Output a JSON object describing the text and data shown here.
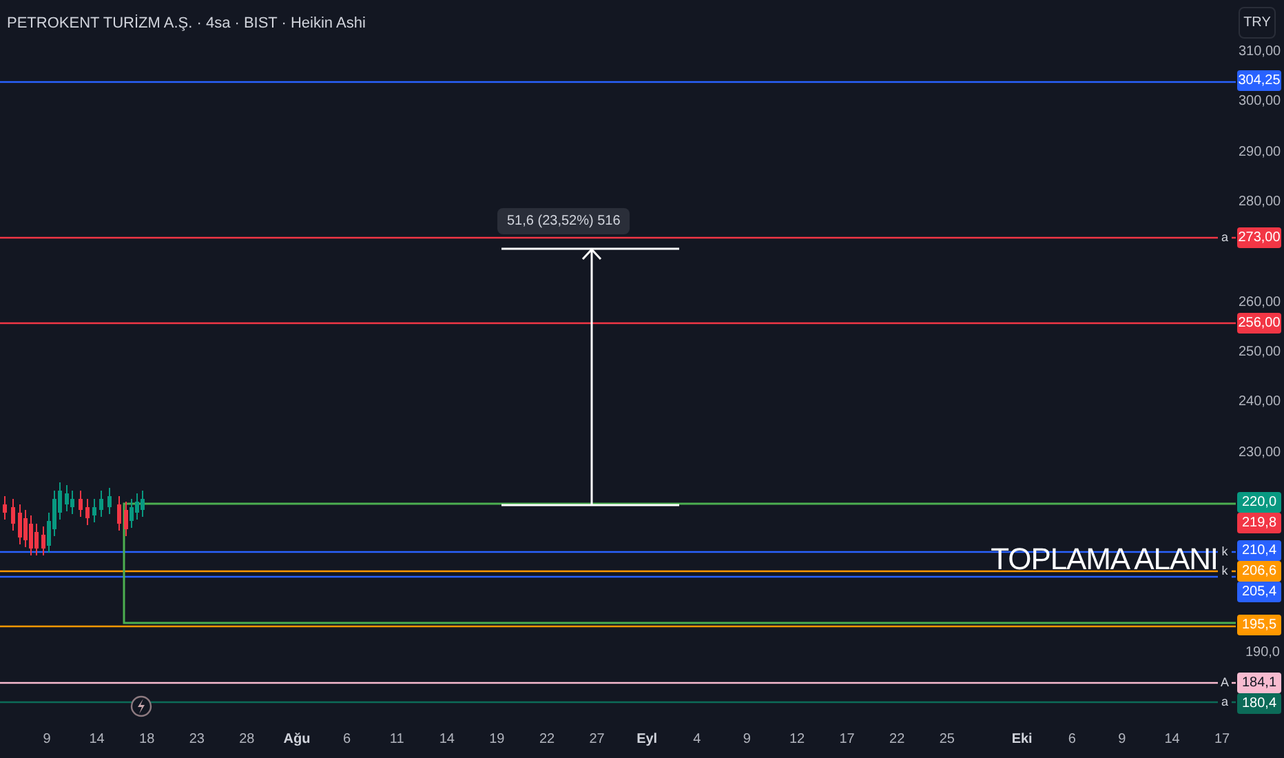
{
  "title": "PETROKENT TURİZM A.Ş. · 4sa · BIST · Heikin Ashi",
  "currency_button": "TRY",
  "price_ticks": [
    "310,00",
    "300,00",
    "290,00",
    "280,00",
    "260,00",
    "250,00",
    "240,00",
    "230,00",
    "190,0"
  ],
  "price_tags": [
    {
      "label": "304,25",
      "color": "#2962ff",
      "kind": "level"
    },
    {
      "label": "273,00",
      "color": "#f23645",
      "kind": "level",
      "marker": "a"
    },
    {
      "label": "256,00",
      "color": "#f23645",
      "kind": "level"
    },
    {
      "label": "220,0",
      "color": "#089981",
      "kind": "price"
    },
    {
      "label": "219,8",
      "color": "#f23645",
      "kind": "price"
    },
    {
      "label": "210,4",
      "color": "#2962ff",
      "kind": "level",
      "marker": "k"
    },
    {
      "label": "206,6",
      "color": "#ff9800",
      "kind": "level",
      "marker": "k"
    },
    {
      "label": "205,4",
      "color": "#2962ff",
      "kind": "level"
    },
    {
      "label": "195,5",
      "color": "#ff9800",
      "kind": "level"
    },
    {
      "label": "184,1",
      "color": "#f8bbd0",
      "kind": "level",
      "marker": "A"
    },
    {
      "label": "180,4",
      "color": "#0c6b58",
      "kind": "level",
      "marker": "a"
    }
  ],
  "measure": {
    "label": "51,6 (23,52%) 516"
  },
  "zone_label": "TOPLAMA ALANI",
  "time_labels": [
    {
      "label": "9",
      "kind": "day"
    },
    {
      "label": "14",
      "kind": "day"
    },
    {
      "label": "18",
      "kind": "day"
    },
    {
      "label": "23",
      "kind": "day"
    },
    {
      "label": "28",
      "kind": "day"
    },
    {
      "label": "Ağu",
      "kind": "month"
    },
    {
      "label": "6",
      "kind": "day"
    },
    {
      "label": "11",
      "kind": "day"
    },
    {
      "label": "14",
      "kind": "day"
    },
    {
      "label": "19",
      "kind": "day"
    },
    {
      "label": "22",
      "kind": "day"
    },
    {
      "label": "27",
      "kind": "day"
    },
    {
      "label": "Eyl",
      "kind": "month"
    },
    {
      "label": "4",
      "kind": "day"
    },
    {
      "label": "9",
      "kind": "day"
    },
    {
      "label": "12",
      "kind": "day"
    },
    {
      "label": "17",
      "kind": "day"
    },
    {
      "label": "22",
      "kind": "day"
    },
    {
      "label": "25",
      "kind": "day"
    },
    {
      "label": "Eki",
      "kind": "month"
    },
    {
      "label": "6",
      "kind": "day"
    },
    {
      "label": "9",
      "kind": "day"
    },
    {
      "label": "14",
      "kind": "day"
    },
    {
      "label": "17",
      "kind": "day"
    }
  ]
}
